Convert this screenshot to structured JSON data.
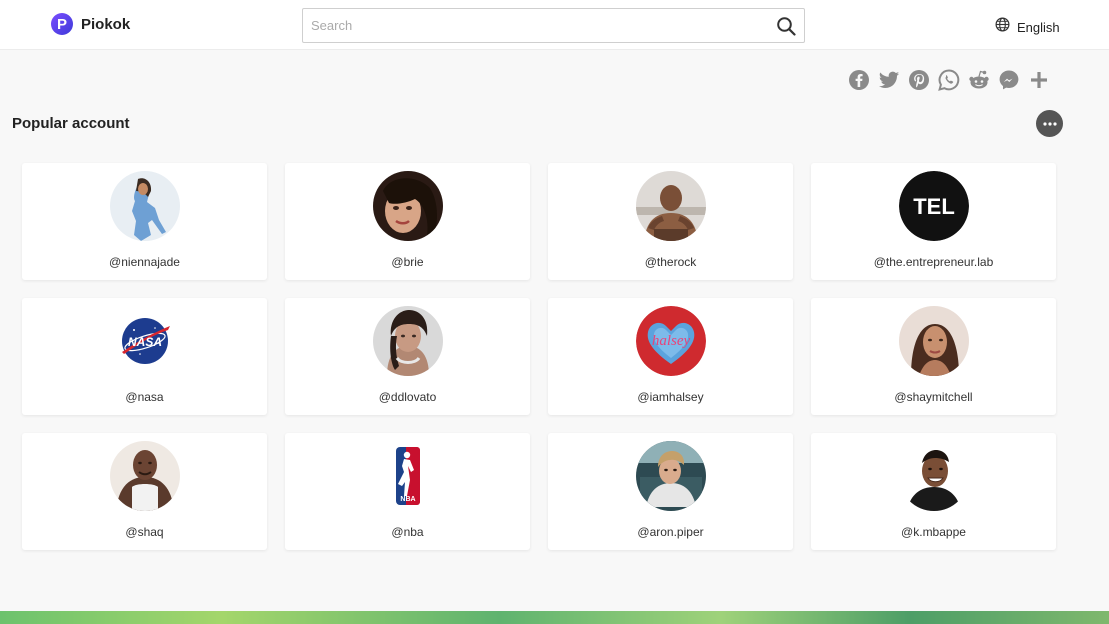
{
  "header": {
    "brand": "Piokok",
    "logo_letter": "P",
    "search": {
      "placeholder": "Search",
      "value": ""
    },
    "language": "English"
  },
  "share_icons": [
    "facebook-icon",
    "twitter-icon",
    "pinterest-icon",
    "whatsapp-icon",
    "reddit-icon",
    "messenger-icon",
    "plus-icon"
  ],
  "section": {
    "title": "Popular account"
  },
  "accounts": [
    {
      "handle": "@niennajade"
    },
    {
      "handle": "@brie"
    },
    {
      "handle": "@therock"
    },
    {
      "handle": "@the.entrepreneur.lab",
      "avatar_text": "TEL"
    },
    {
      "handle": "@nasa",
      "avatar_text": "NASA"
    },
    {
      "handle": "@ddlovato"
    },
    {
      "handle": "@iamhalsey",
      "avatar_text": "halsey"
    },
    {
      "handle": "@shaymitchell"
    },
    {
      "handle": "@shaq"
    },
    {
      "handle": "@nba",
      "avatar_text": "NBA"
    },
    {
      "handle": "@aron.piper"
    },
    {
      "handle": "@k.mbappe"
    }
  ],
  "colors": {
    "accent": "#5b45e8",
    "icon_gray": "#8a8a8a",
    "background": "#f8f8f8",
    "card": "#ffffff"
  }
}
